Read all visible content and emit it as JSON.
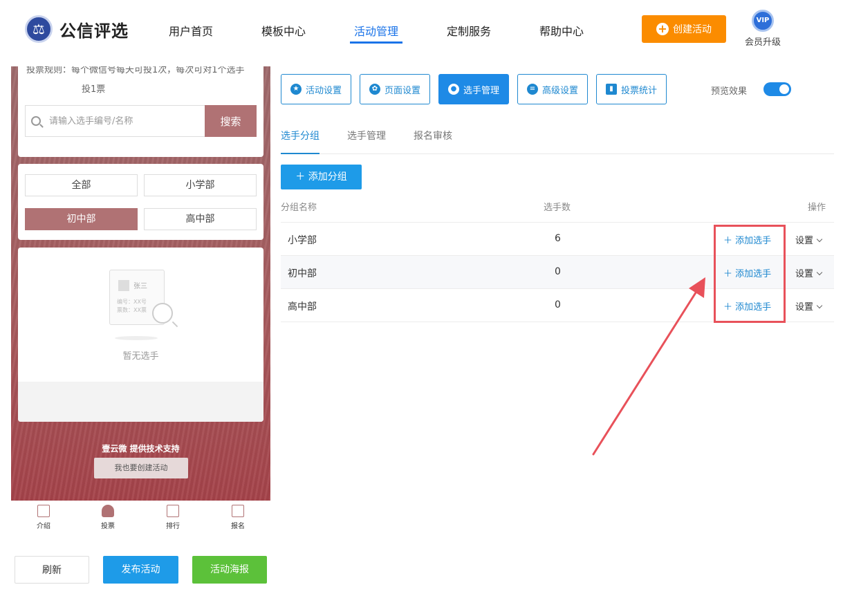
{
  "header": {
    "brand": "公信评选",
    "nav": [
      {
        "label": "用户首页"
      },
      {
        "label": "模板中心"
      },
      {
        "label": "活动管理"
      },
      {
        "label": "定制服务"
      },
      {
        "label": "帮助中心"
      }
    ],
    "create_label": "创建活动",
    "vip_badge": "VIP",
    "vip_label": "会员升级"
  },
  "phone": {
    "cut_text": "投票规则：每个微信号每天可投1次，每次可对1个选手",
    "vote_rule": "投1票",
    "search_placeholder": "请输入选手编号/名称",
    "search_button": "搜索",
    "groups": [
      "全部",
      "小学部",
      "初中部",
      "高中部"
    ],
    "active_group": "初中部",
    "empty": {
      "name": "张三",
      "line1": "编号：XX号",
      "line2": "票数：XX票",
      "text": "暂无选手"
    },
    "support": "壹云微 提供技术支持",
    "create_too": "我也要创建活动",
    "tabs": [
      "介绍",
      "投票",
      "排行",
      "报名"
    ]
  },
  "actions": {
    "refresh": "刷新",
    "publish": "发布活动",
    "poster": "活动海报"
  },
  "toolbar": {
    "items": [
      "活动设置",
      "页面设置",
      "选手管理",
      "高级设置",
      "投票统计"
    ],
    "active": "选手管理",
    "preview_label": "预览效果"
  },
  "subtabs": [
    "选手分组",
    "选手管理",
    "报名审核"
  ],
  "add_group": "添加分组",
  "table": {
    "headers": {
      "name": "分组名称",
      "count": "选手数",
      "ops": "操作"
    },
    "rows": [
      {
        "name": "小学部",
        "count": "6",
        "add": "添加选手",
        "set": "设置"
      },
      {
        "name": "初中部",
        "count": "0",
        "add": "添加选手",
        "set": "设置"
      },
      {
        "name": "高中部",
        "count": "0",
        "add": "添加选手",
        "set": "设置"
      }
    ]
  },
  "colors": {
    "primary": "#1e88d0",
    "orange": "#fb8c00",
    "theme": "#b07274",
    "green": "#5cc13a",
    "highlight": "#e8515a"
  }
}
